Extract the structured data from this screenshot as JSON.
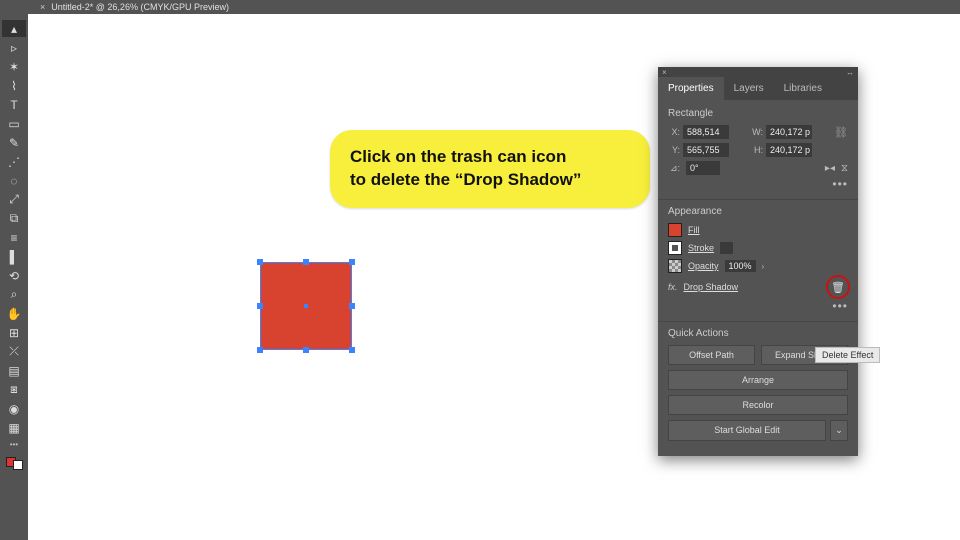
{
  "tab": {
    "close": "×",
    "title": "Untitled-2* @ 26,26% (CMYK/GPU Preview)"
  },
  "toolbar": {
    "tools": [
      "▴",
      "▹",
      "✶",
      "⌇",
      "T",
      "▭",
      "✎",
      "⋰",
      "◌",
      "⤢",
      "⧉",
      "≡",
      "▌",
      "⟲",
      "⌕",
      "✋",
      "⊞",
      "⤫",
      "▤",
      "⧆",
      "◉",
      "▦"
    ]
  },
  "panel": {
    "tabs": {
      "properties": "Properties",
      "layers": "Layers",
      "libraries": "Libraries"
    },
    "section_transform": "Rectangle",
    "fields": {
      "x_label": "X:",
      "x_val": "588,514",
      "y_label": "Y:",
      "y_val": "565,755",
      "w_label": "W:",
      "w_val": "240,172 p",
      "h_label": "H:",
      "h_val": "240,172 p",
      "angle_label": "⊿:",
      "angle_val": "0°"
    },
    "section_appearance": "Appearance",
    "appearance": {
      "fill": "Fill",
      "stroke": "Stroke",
      "opacity": "Opacity",
      "opacity_val": "100%",
      "fx_prefix": "fx.",
      "fx_name": "Drop Shadow"
    },
    "tooltip": "Delete Effect",
    "section_quick": "Quick Actions",
    "quick": {
      "offset": "Offset Path",
      "expand": "Expand Shape",
      "arrange": "Arrange",
      "recolor": "Recolor",
      "global": "Start Global Edit",
      "caret": "⌄"
    }
  },
  "callout": {
    "line1": "Click on the trash can icon",
    "line2": "to delete the “Drop Shadow”"
  }
}
